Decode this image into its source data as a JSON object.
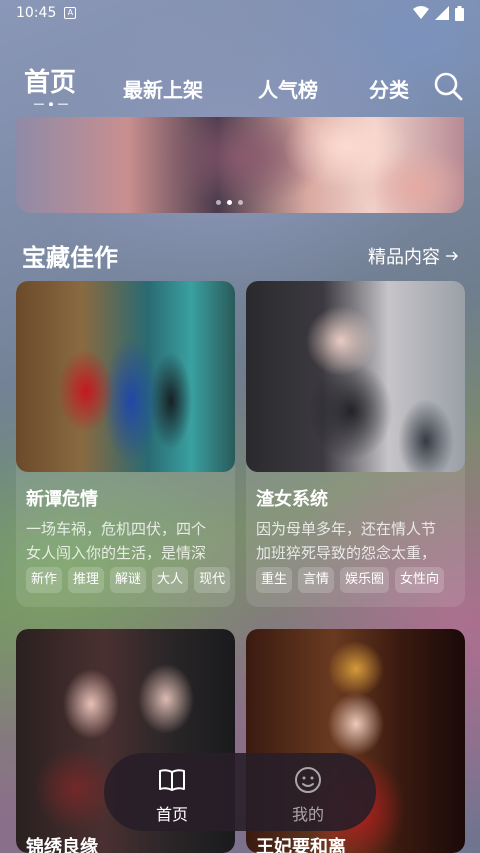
{
  "status_bar": {
    "time": "10:45",
    "app_badge": "A"
  },
  "top_nav": {
    "tabs": [
      {
        "label": "首页",
        "active": true
      },
      {
        "label": "最新上架",
        "active": false
      },
      {
        "label": "人气榜",
        "active": false
      },
      {
        "label": "分类",
        "active": false
      }
    ],
    "search_icon": "search-icon"
  },
  "banner": {
    "dots": 3,
    "active_dot": 1
  },
  "section": {
    "title": "宝藏佳作",
    "more_label": "精品内容",
    "more_icon": "arrow-right-icon"
  },
  "books": [
    {
      "title": "新谭危情",
      "desc_lines": [
        "一场车祸，危机四伏，四个",
        "女人闯入你的生活，是情深"
      ],
      "tags": [
        "新作",
        "推理",
        "解谜",
        "大人",
        "现代"
      ]
    },
    {
      "title": "渣女系统",
      "desc_lines": [
        "因为母单多年，还在情人节",
        "加班猝死导致的怨念太重，"
      ],
      "tags": [
        "重生",
        "言情",
        "娱乐圈",
        "女性向"
      ]
    },
    {
      "title": "锦绣良缘"
    },
    {
      "title": "王妃要和离"
    }
  ],
  "bottom_nav": {
    "items": [
      {
        "label": "首页",
        "icon": "book-icon",
        "active": true
      },
      {
        "label": "我的",
        "icon": "profile-icon",
        "active": false
      }
    ]
  }
}
